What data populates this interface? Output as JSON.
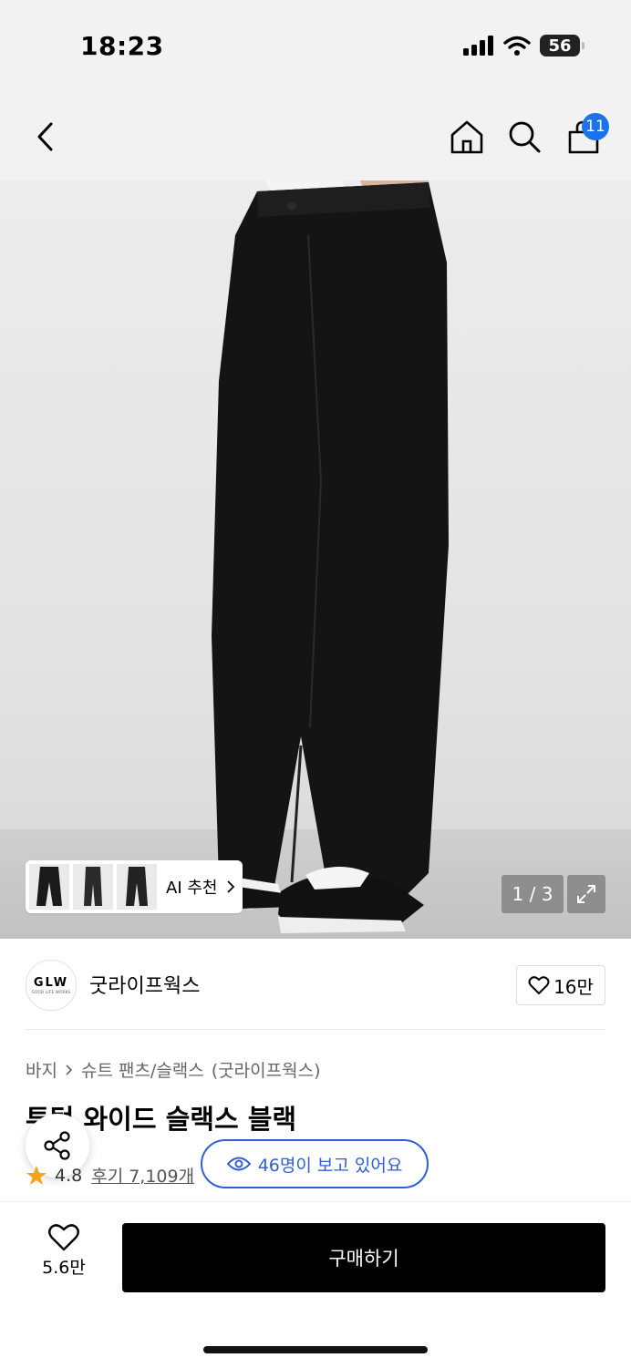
{
  "status_bar": {
    "time": "18:23",
    "battery": "56"
  },
  "nav": {
    "cart_count": "11"
  },
  "gallery": {
    "ai_label": "AI 추천",
    "page_indicator": "1 / 3"
  },
  "brand": {
    "logo_text": "GLW",
    "logo_subtext": "GOOD LIFE WORKS",
    "name": "굿라이프웍스",
    "likes": "16만"
  },
  "breadcrumb": [
    "바지",
    "슈트 팬츠/슬랙스",
    "(굿라이프웍스)"
  ],
  "product": {
    "title": "투턱 와이드 슬랙스 블랙",
    "rating": "4.8",
    "reviews": "후기 7,109개",
    "viewers": "46명이 보고 있어요"
  },
  "bottom": {
    "wish_count": "5.6만",
    "buy_label": "구매하기"
  },
  "colors": {
    "accent_blue": "#2f5fd0",
    "badge_blue": "#1a73e8",
    "star": "#f7a21b"
  }
}
